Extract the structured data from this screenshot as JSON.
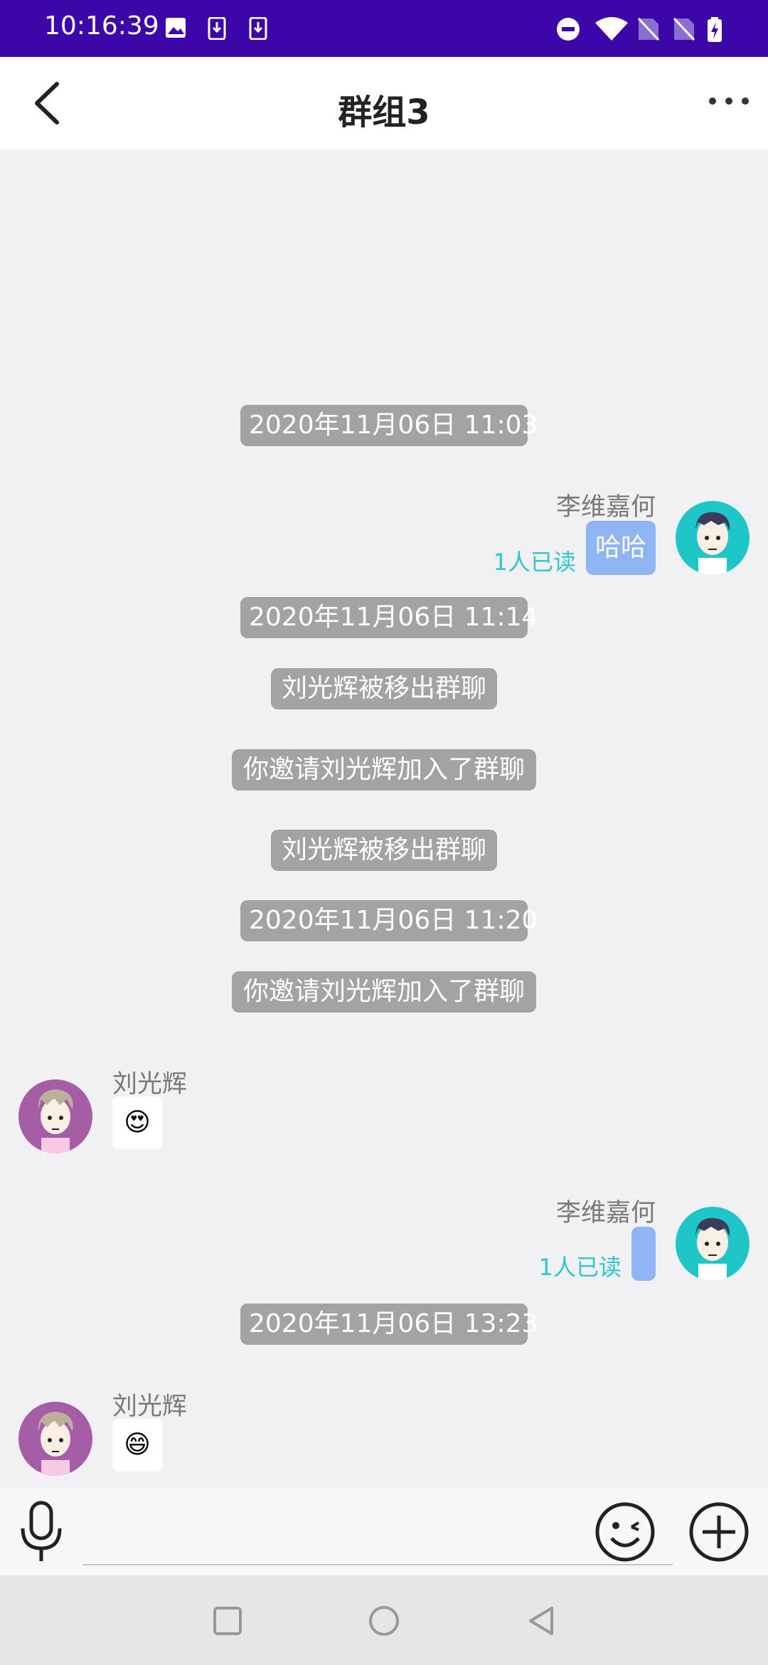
{
  "status_bar": {
    "time": "10:16:39"
  },
  "header": {
    "title": "群组3"
  },
  "messages": {
    "ts1": "2020年11月06日 11:03",
    "m1": {
      "sender": "李维嘉何",
      "text": "哈哈",
      "read": "1人已读"
    },
    "ts2": "2020年11月06日 11:14",
    "sys1": "刘光辉被移出群聊",
    "sys2": "你邀请刘光辉加入了群聊",
    "sys3": "刘光辉被移出群聊",
    "ts3": "2020年11月06日 11:20",
    "sys4": "你邀请刘光辉加入了群聊",
    "m2": {
      "sender": "刘光辉",
      "emoji": "😍"
    },
    "m3": {
      "sender": "李维嘉何",
      "text": "",
      "read": "1人已读"
    },
    "ts4": "2020年11月06日 13:23",
    "m4": {
      "sender": "刘光辉",
      "emoji": "😄"
    }
  },
  "input": {
    "placeholder": ""
  },
  "colors": {
    "status_bar": "#3c07a8",
    "outgoing_bubble": "#8fb5f5",
    "read_receipt": "#2fc7c7",
    "timestamp_pill": "#a3a3a3"
  },
  "icons": [
    "back-arrow-icon",
    "more-dots-icon",
    "microphone-icon",
    "emoji-icon",
    "plus-icon",
    "nav-square-icon",
    "nav-circle-icon",
    "nav-back-icon"
  ]
}
